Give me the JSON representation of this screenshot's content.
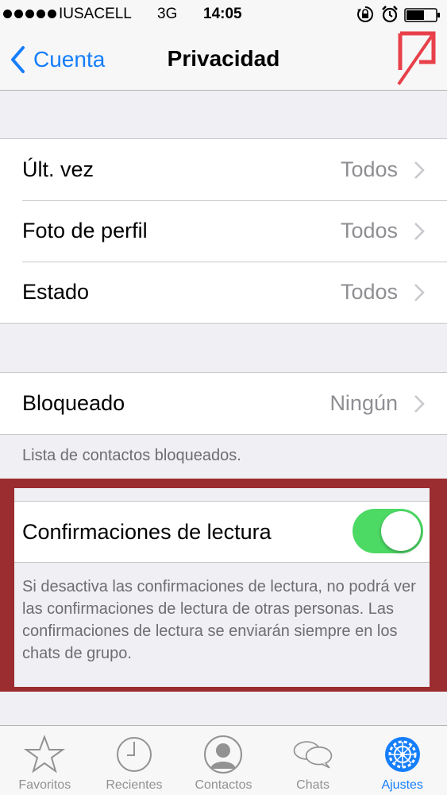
{
  "status_bar": {
    "carrier": "IUSACELL",
    "network": "3G",
    "time": "14:05"
  },
  "nav": {
    "back_label": "Cuenta",
    "title": "Privacidad"
  },
  "groups": {
    "visibility": [
      {
        "label": "Últ. vez",
        "value": "Todos"
      },
      {
        "label": "Foto de perfil",
        "value": "Todos"
      },
      {
        "label": "Estado",
        "value": "Todos"
      }
    ],
    "blocked": {
      "label": "Bloqueado",
      "value": "Ningún"
    },
    "blocked_footnote": "Lista de contactos bloqueados."
  },
  "read_receipts": {
    "label": "Confirmaciones de lectura",
    "enabled": true,
    "description": "Si desactiva las confirmaciones de lectura, no podrá ver las confirmaciones de lectura de otras personas. Las confirmaciones de lectura se enviarán siempre en los chats de grupo."
  },
  "tabs": [
    {
      "label": "Favoritos",
      "icon": "star-icon",
      "active": false
    },
    {
      "label": "Recientes",
      "icon": "clock-icon",
      "active": false
    },
    {
      "label": "Contactos",
      "icon": "contact-icon",
      "active": false
    },
    {
      "label": "Chats",
      "icon": "chat-bubbles-icon",
      "active": false
    },
    {
      "label": "Ajustes",
      "icon": "gear-icon",
      "active": true
    }
  ],
  "colors": {
    "accent": "#157efb",
    "toggle_on": "#4cd964",
    "highlight": "#9b2c2f",
    "logo": "#e8404a"
  }
}
